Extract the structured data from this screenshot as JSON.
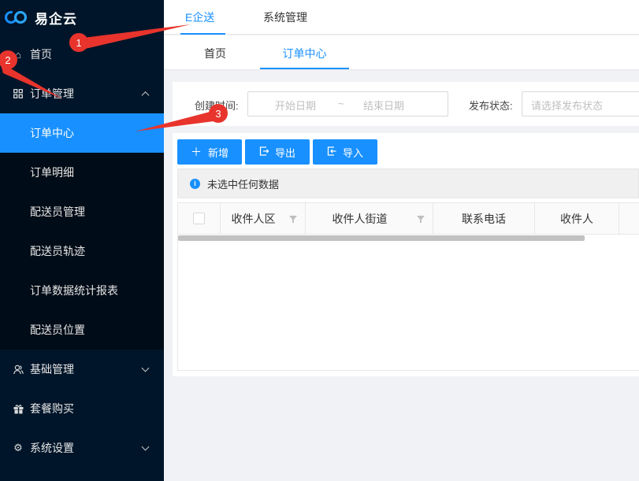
{
  "app": {
    "logo_text": "易企云"
  },
  "sidebar": {
    "home": "首页",
    "order_mgmt": "订单管理",
    "sub_items": [
      "订单中心",
      "订单明细",
      "配送员管理",
      "配送员轨迹",
      "订单数据统计报表",
      "配送员位置"
    ],
    "basic_mgmt": "基础管理",
    "package": "套餐购买",
    "settings": "系统设置"
  },
  "top_tabs": [
    "E企送",
    "系统管理"
  ],
  "page_tabs": [
    "首页",
    "订单中心"
  ],
  "search": {
    "created_label": "创建时间:",
    "start_placeholder": "开始日期",
    "separator": "~",
    "end_placeholder": "结束日期",
    "status_label": "发布状态:",
    "status_placeholder": "请选择发布状态"
  },
  "toolbar": {
    "add": "新增",
    "export": "导出",
    "import": "导入"
  },
  "alert": {
    "text": "未选中任何数据"
  },
  "table": {
    "columns": [
      "收件人区",
      "收件人街道",
      "联系电话",
      "收件人"
    ]
  },
  "annotations": [
    "1",
    "2",
    "3"
  ],
  "colors": {
    "primary": "#1890ff",
    "sidebar_bg": "#001529",
    "annotation_red": "#e8342c"
  }
}
